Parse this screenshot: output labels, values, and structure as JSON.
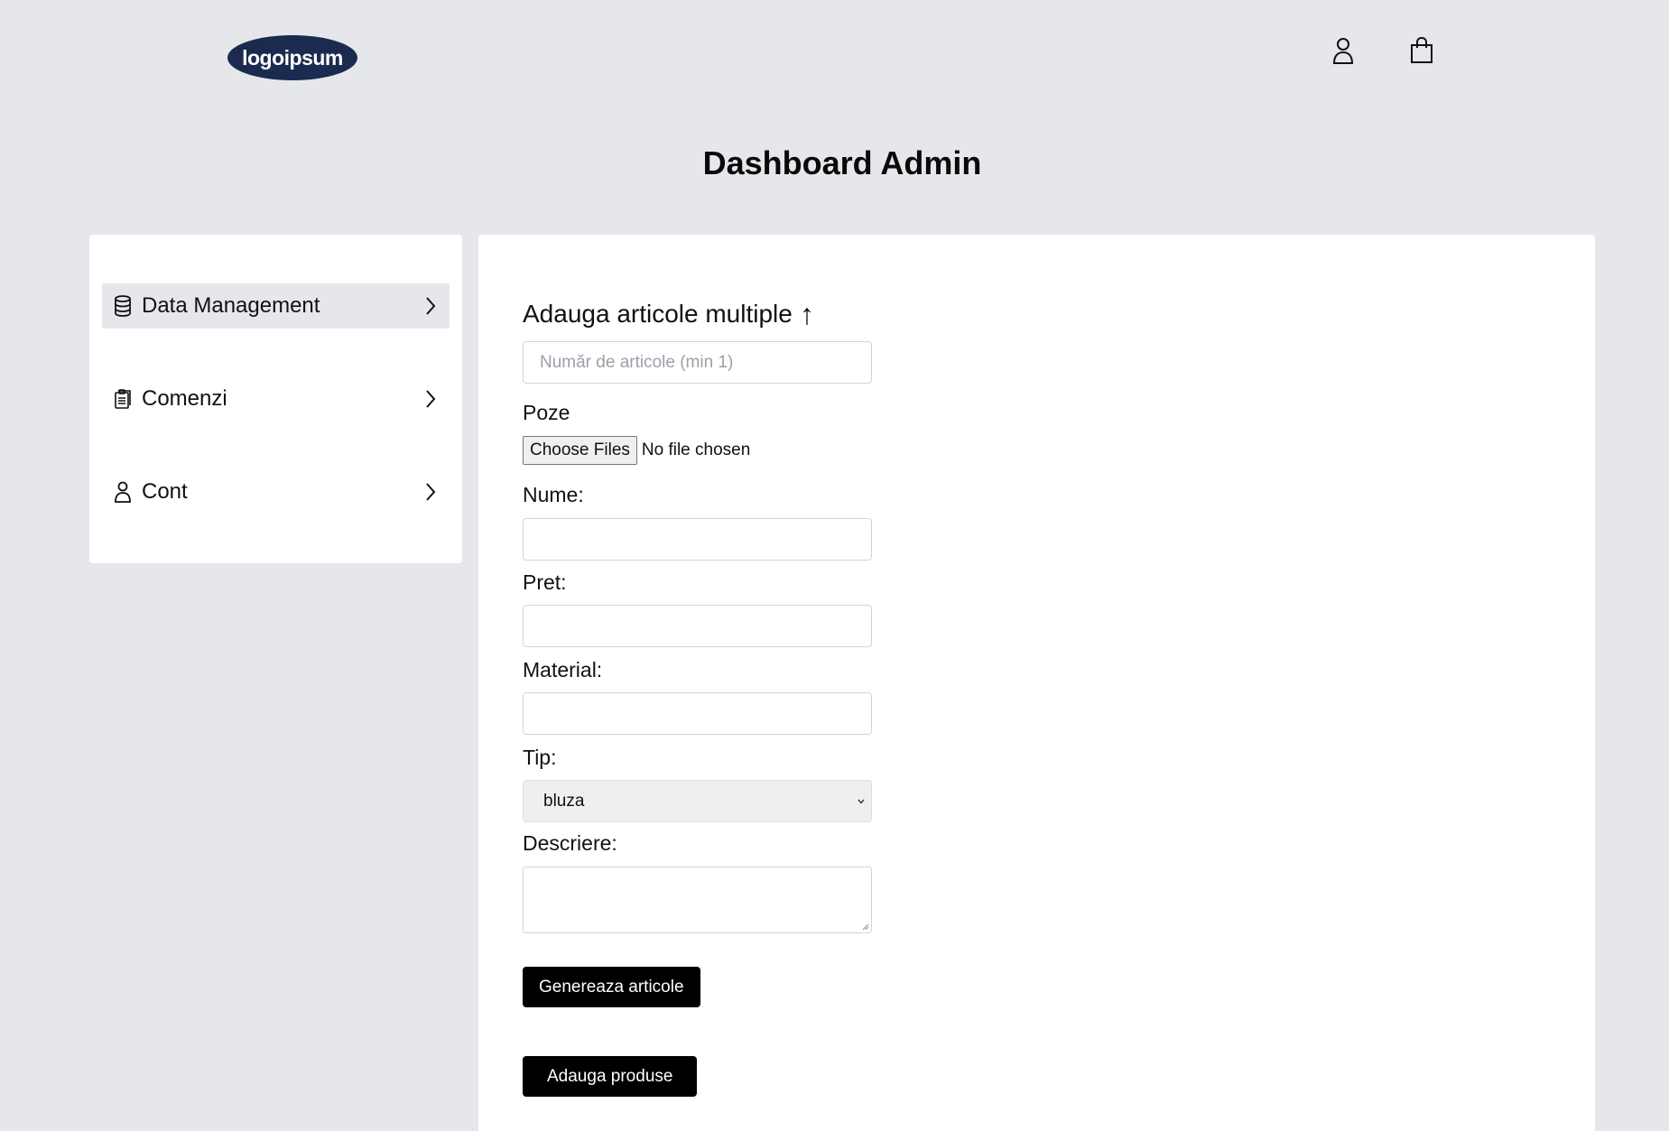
{
  "header": {
    "logo_text": "logoipsum",
    "user_icon": "user-icon",
    "bag_icon": "shopping-bag-icon"
  },
  "page_title": "Dashboard Admin",
  "sidebar": {
    "items": [
      {
        "label": "Data Management",
        "icon": "database-icon",
        "active": true
      },
      {
        "label": "Comenzi",
        "icon": "clipboard-icon",
        "active": false
      },
      {
        "label": "Cont",
        "icon": "user-icon",
        "active": false
      }
    ]
  },
  "form": {
    "title": "Adauga articole multiple",
    "title_arrow": "↑",
    "count_placeholder": "Număr de articole (min 1)",
    "count_value": "",
    "photos_label": "Poze",
    "file_button": "Choose Files",
    "file_status": "No file chosen",
    "name_label": "Nume:",
    "name_value": "",
    "price_label": "Pret:",
    "price_value": "",
    "material_label": "Material:",
    "material_value": "",
    "type_label": "Tip:",
    "type_selected": "bluza",
    "description_label": "Descriere:",
    "description_value": "",
    "generate_button": "Genereaza articole",
    "add_button": "Adauga produse"
  },
  "colors": {
    "background": "#e5e7eb",
    "logo_bg": "#1b2b4f",
    "button_bg": "#000000",
    "active_item_bg": "#e5e7eb"
  }
}
